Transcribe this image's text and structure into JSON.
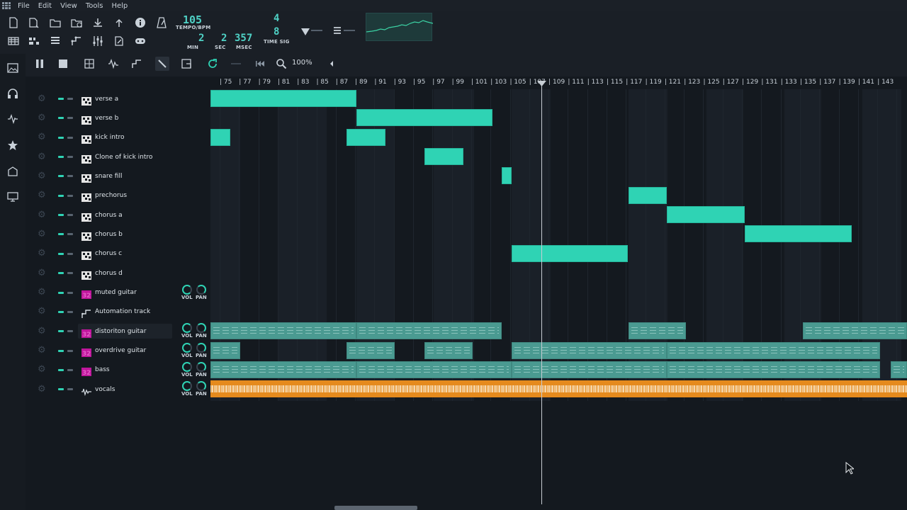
{
  "menu": [
    "File",
    "Edit",
    "View",
    "Tools",
    "Help"
  ],
  "lcd": {
    "tempo": "105",
    "tempo_label": "TEMPO/BPM",
    "min": "2",
    "min_label": "MIN",
    "sec": "2",
    "sec_label": "SEC",
    "msec": "357",
    "msec_label": "MSEC",
    "timesig_num": "4",
    "timesig_den": "8",
    "timesig_label": "TIME SIG"
  },
  "zoom": "100%",
  "ruler": [
    "75",
    "77",
    "79",
    "81",
    "83",
    "85",
    "87",
    "89",
    "91",
    "93",
    "95",
    "97",
    "99",
    "101",
    "103",
    "105",
    "107",
    "109",
    "111",
    "113",
    "115",
    "117",
    "119",
    "121",
    "123",
    "125",
    "127",
    "129",
    "131",
    "133",
    "135",
    "137",
    "139",
    "141",
    "143"
  ],
  "knob_labels": {
    "vol": "VOL",
    "pan": "PAN"
  },
  "tracks": [
    {
      "name": "verse a",
      "type": "pattern"
    },
    {
      "name": "verse b",
      "type": "pattern"
    },
    {
      "name": "kick intro",
      "type": "pattern"
    },
    {
      "name": "Clone of kick intro",
      "type": "pattern"
    },
    {
      "name": "snare fill",
      "type": "pattern"
    },
    {
      "name": "prechorus",
      "type": "pattern"
    },
    {
      "name": "chorus a",
      "type": "pattern"
    },
    {
      "name": "chorus b",
      "type": "pattern"
    },
    {
      "name": "chorus c",
      "type": "pattern"
    },
    {
      "name": "chorus d",
      "type": "pattern"
    },
    {
      "name": "muted guitar",
      "type": "instrument"
    },
    {
      "name": "Automation track",
      "type": "automation"
    },
    {
      "name": "distoriton guitar",
      "type": "instrument"
    },
    {
      "name": "overdrive guitar",
      "type": "instrument"
    },
    {
      "name": "bass",
      "type": "instrument"
    },
    {
      "name": "vocals",
      "type": "audio"
    }
  ],
  "colors": {
    "pattern_clip": "#2fd3b4",
    "instrument_clip": "#4a9a91",
    "audio_clip": "#e58a1d",
    "lcd": "#4fd1c5",
    "instrument_icon": "#c0169c"
  }
}
